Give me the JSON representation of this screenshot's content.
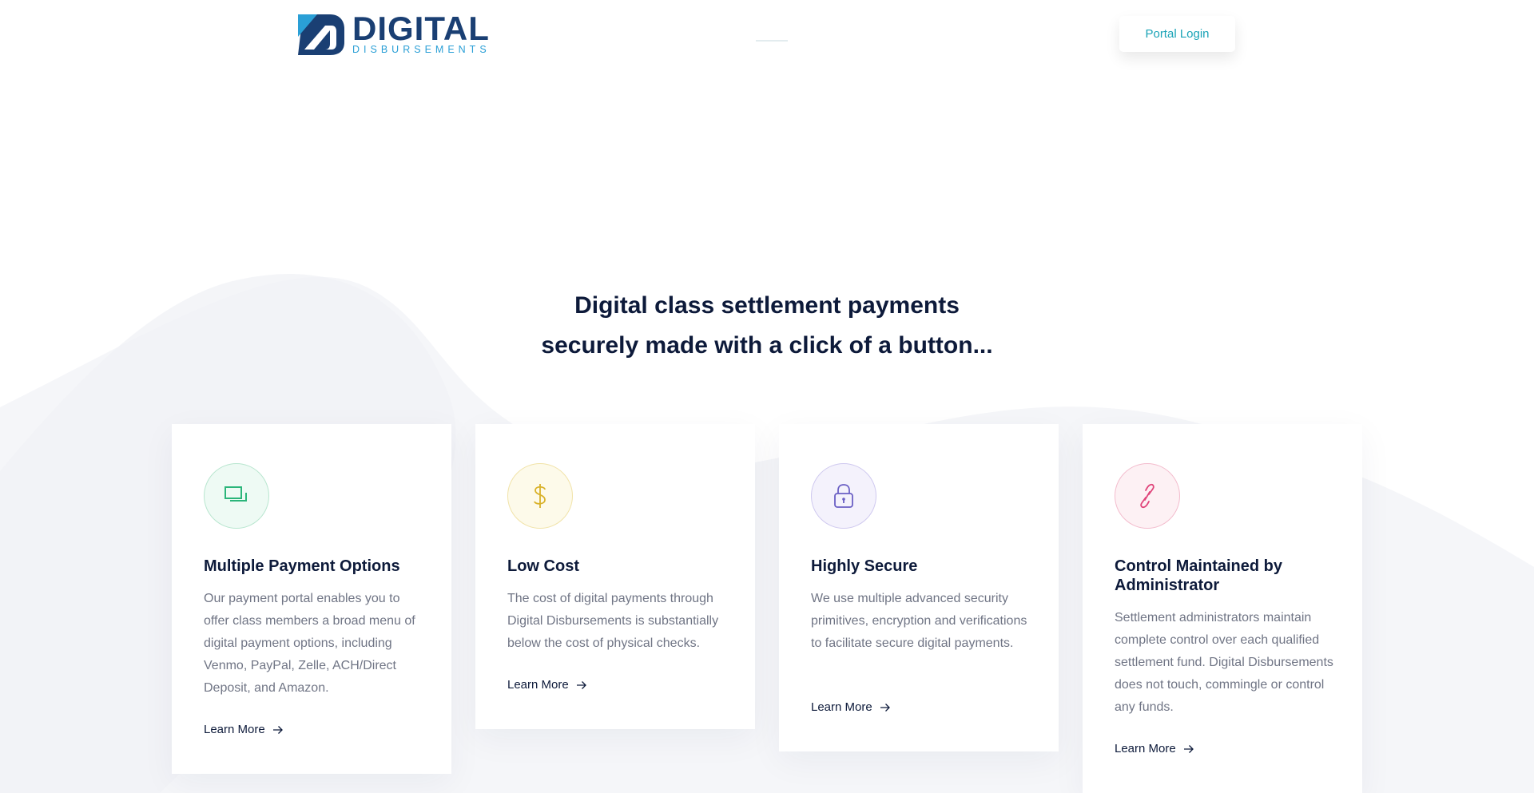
{
  "header": {
    "logo_word": "DIGITAL",
    "logo_sub": "DISBURSEMENTS",
    "portal_login": "Portal Login"
  },
  "hero": {
    "line1": "Digital class settlement payments",
    "line2": "securely made with a click of a button..."
  },
  "cards": [
    {
      "icon": "payment-cards-icon",
      "icon_color": "#2bb57a",
      "title": "Multiple Payment Options",
      "text": "Our payment portal enables you to offer class members a broad menu of digital payment options, including Venmo, PayPal, Zelle, ACH/Direct Deposit, and Amazon.",
      "link": "Learn More"
    },
    {
      "icon": "dollar-icon",
      "icon_color": "#d9b22b",
      "title": "Low Cost",
      "text": "The cost of digital payments through Digital Disbursements is substantially below the cost of physical checks.",
      "link": "Learn More"
    },
    {
      "icon": "lock-icon",
      "icon_color": "#6a5fc4",
      "title": "Highly Secure",
      "text": "We use multiple advanced security primitives, encryption and verifications to facilitate secure digital payments.",
      "link": "Learn More"
    },
    {
      "icon": "link-icon",
      "icon_color": "#e0457a",
      "title": "Control Maintained by Administrator",
      "text": "Settlement administrators maintain complete control over each qualified settlement fund. Digital Disbursements does not touch, commingle or control any funds.",
      "link": "Learn More"
    }
  ]
}
